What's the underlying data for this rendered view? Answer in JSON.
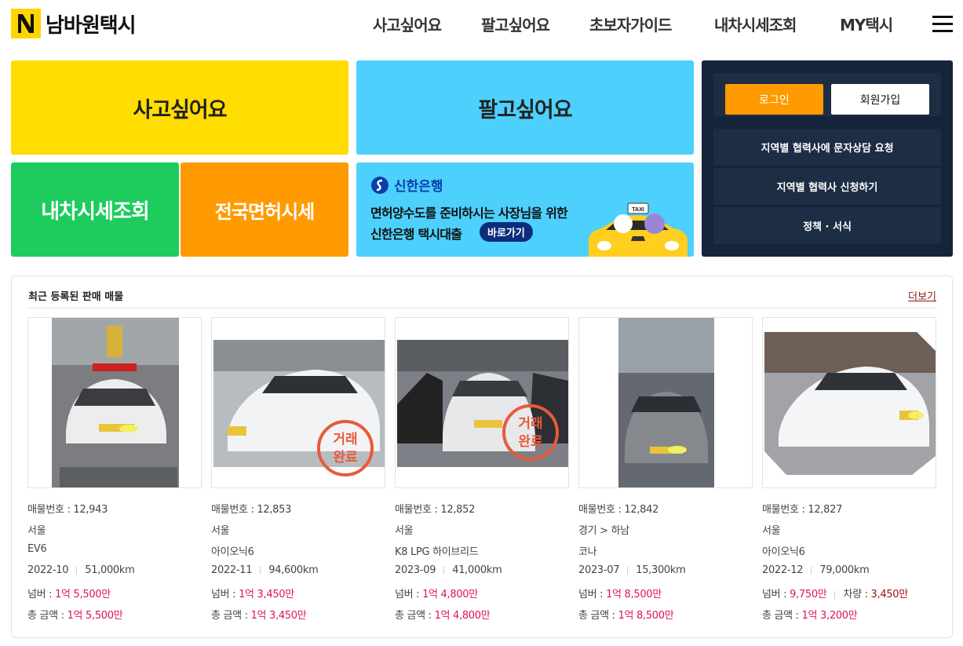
{
  "header": {
    "logo_letter": "N",
    "logo_text": "남바원택시",
    "nav": [
      "사고싶어요",
      "팔고싶어요",
      "초보자가이드",
      "내차시세조회",
      "MY택시"
    ]
  },
  "tiles": {
    "buy": "사고싶어요",
    "sell": "팔고싶어요",
    "price_check": "내차시세조회",
    "license_price": "전국면허시세"
  },
  "banner": {
    "bank_name": "신한은행",
    "line1": "면허양수도를 준비하시는 사장님을 위한",
    "line2": "신한은행 택시대출",
    "button": "바로가기",
    "taxi_sign": "TAXI"
  },
  "panel": {
    "login": "로그인",
    "join": "회원가입",
    "rows": [
      "지역별 협력사에 문자상담 요청",
      "지역별 협력사 신청하기",
      "정책 · 서식"
    ]
  },
  "listing": {
    "title": "최근 등록된 판매 매물",
    "more": "더보기",
    "stamp_line1": "거래",
    "stamp_line2": "완료",
    "cards": [
      {
        "no_label": "매물번호 : 12,943",
        "region": "서울",
        "model": "EV6",
        "date": "2022-10",
        "km": "51,000km",
        "numbar_label": "넘버 : ",
        "numbar": "1억 5,500만",
        "car_label": "",
        "car": "",
        "total_label": "총 금액 : ",
        "total": "1억 5,500만",
        "sold": false
      },
      {
        "no_label": "매물번호 : 12,853",
        "region": "서울",
        "model": "아이오닉6",
        "date": "2022-11",
        "km": "94,600km",
        "numbar_label": "넘버 : ",
        "numbar": "1억 3,450만",
        "car_label": "",
        "car": "",
        "total_label": "총 금액 : ",
        "total": "1억 3,450만",
        "sold": true
      },
      {
        "no_label": "매물번호 : 12,852",
        "region": "서울",
        "model": "K8 LPG 하이브리드",
        "date": "2023-09",
        "km": "41,000km",
        "numbar_label": "넘버 : ",
        "numbar": "1억 4,800만",
        "car_label": "",
        "car": "",
        "total_label": "총 금액 : ",
        "total": "1억 4,800만",
        "sold": true
      },
      {
        "no_label": "매물번호 : 12,842",
        "region": "경기 > 하남",
        "model": "코나",
        "date": "2023-07",
        "km": "15,300km",
        "numbar_label": "넘버 : ",
        "numbar": "1억 8,500만",
        "car_label": "",
        "car": "",
        "total_label": "총 금액 : ",
        "total": "1억 8,500만",
        "sold": false
      },
      {
        "no_label": "매물번호 : 12,827",
        "region": "서울",
        "model": "아이오닉6",
        "date": "2022-12",
        "km": "79,000km",
        "numbar_label": "넘버 : ",
        "numbar": "9,750만",
        "car_label": "차량 : ",
        "car": "3,450만",
        "total_label": "총 금액 : ",
        "total": "1억 3,200만",
        "sold": false
      }
    ]
  },
  "colors": {
    "yellow": "#ffdd00",
    "sky": "#4dd0fc",
    "green": "#1dcc5c",
    "orange": "#ff9a00",
    "navy": "#15243a",
    "price_pink": "#e0105a"
  }
}
